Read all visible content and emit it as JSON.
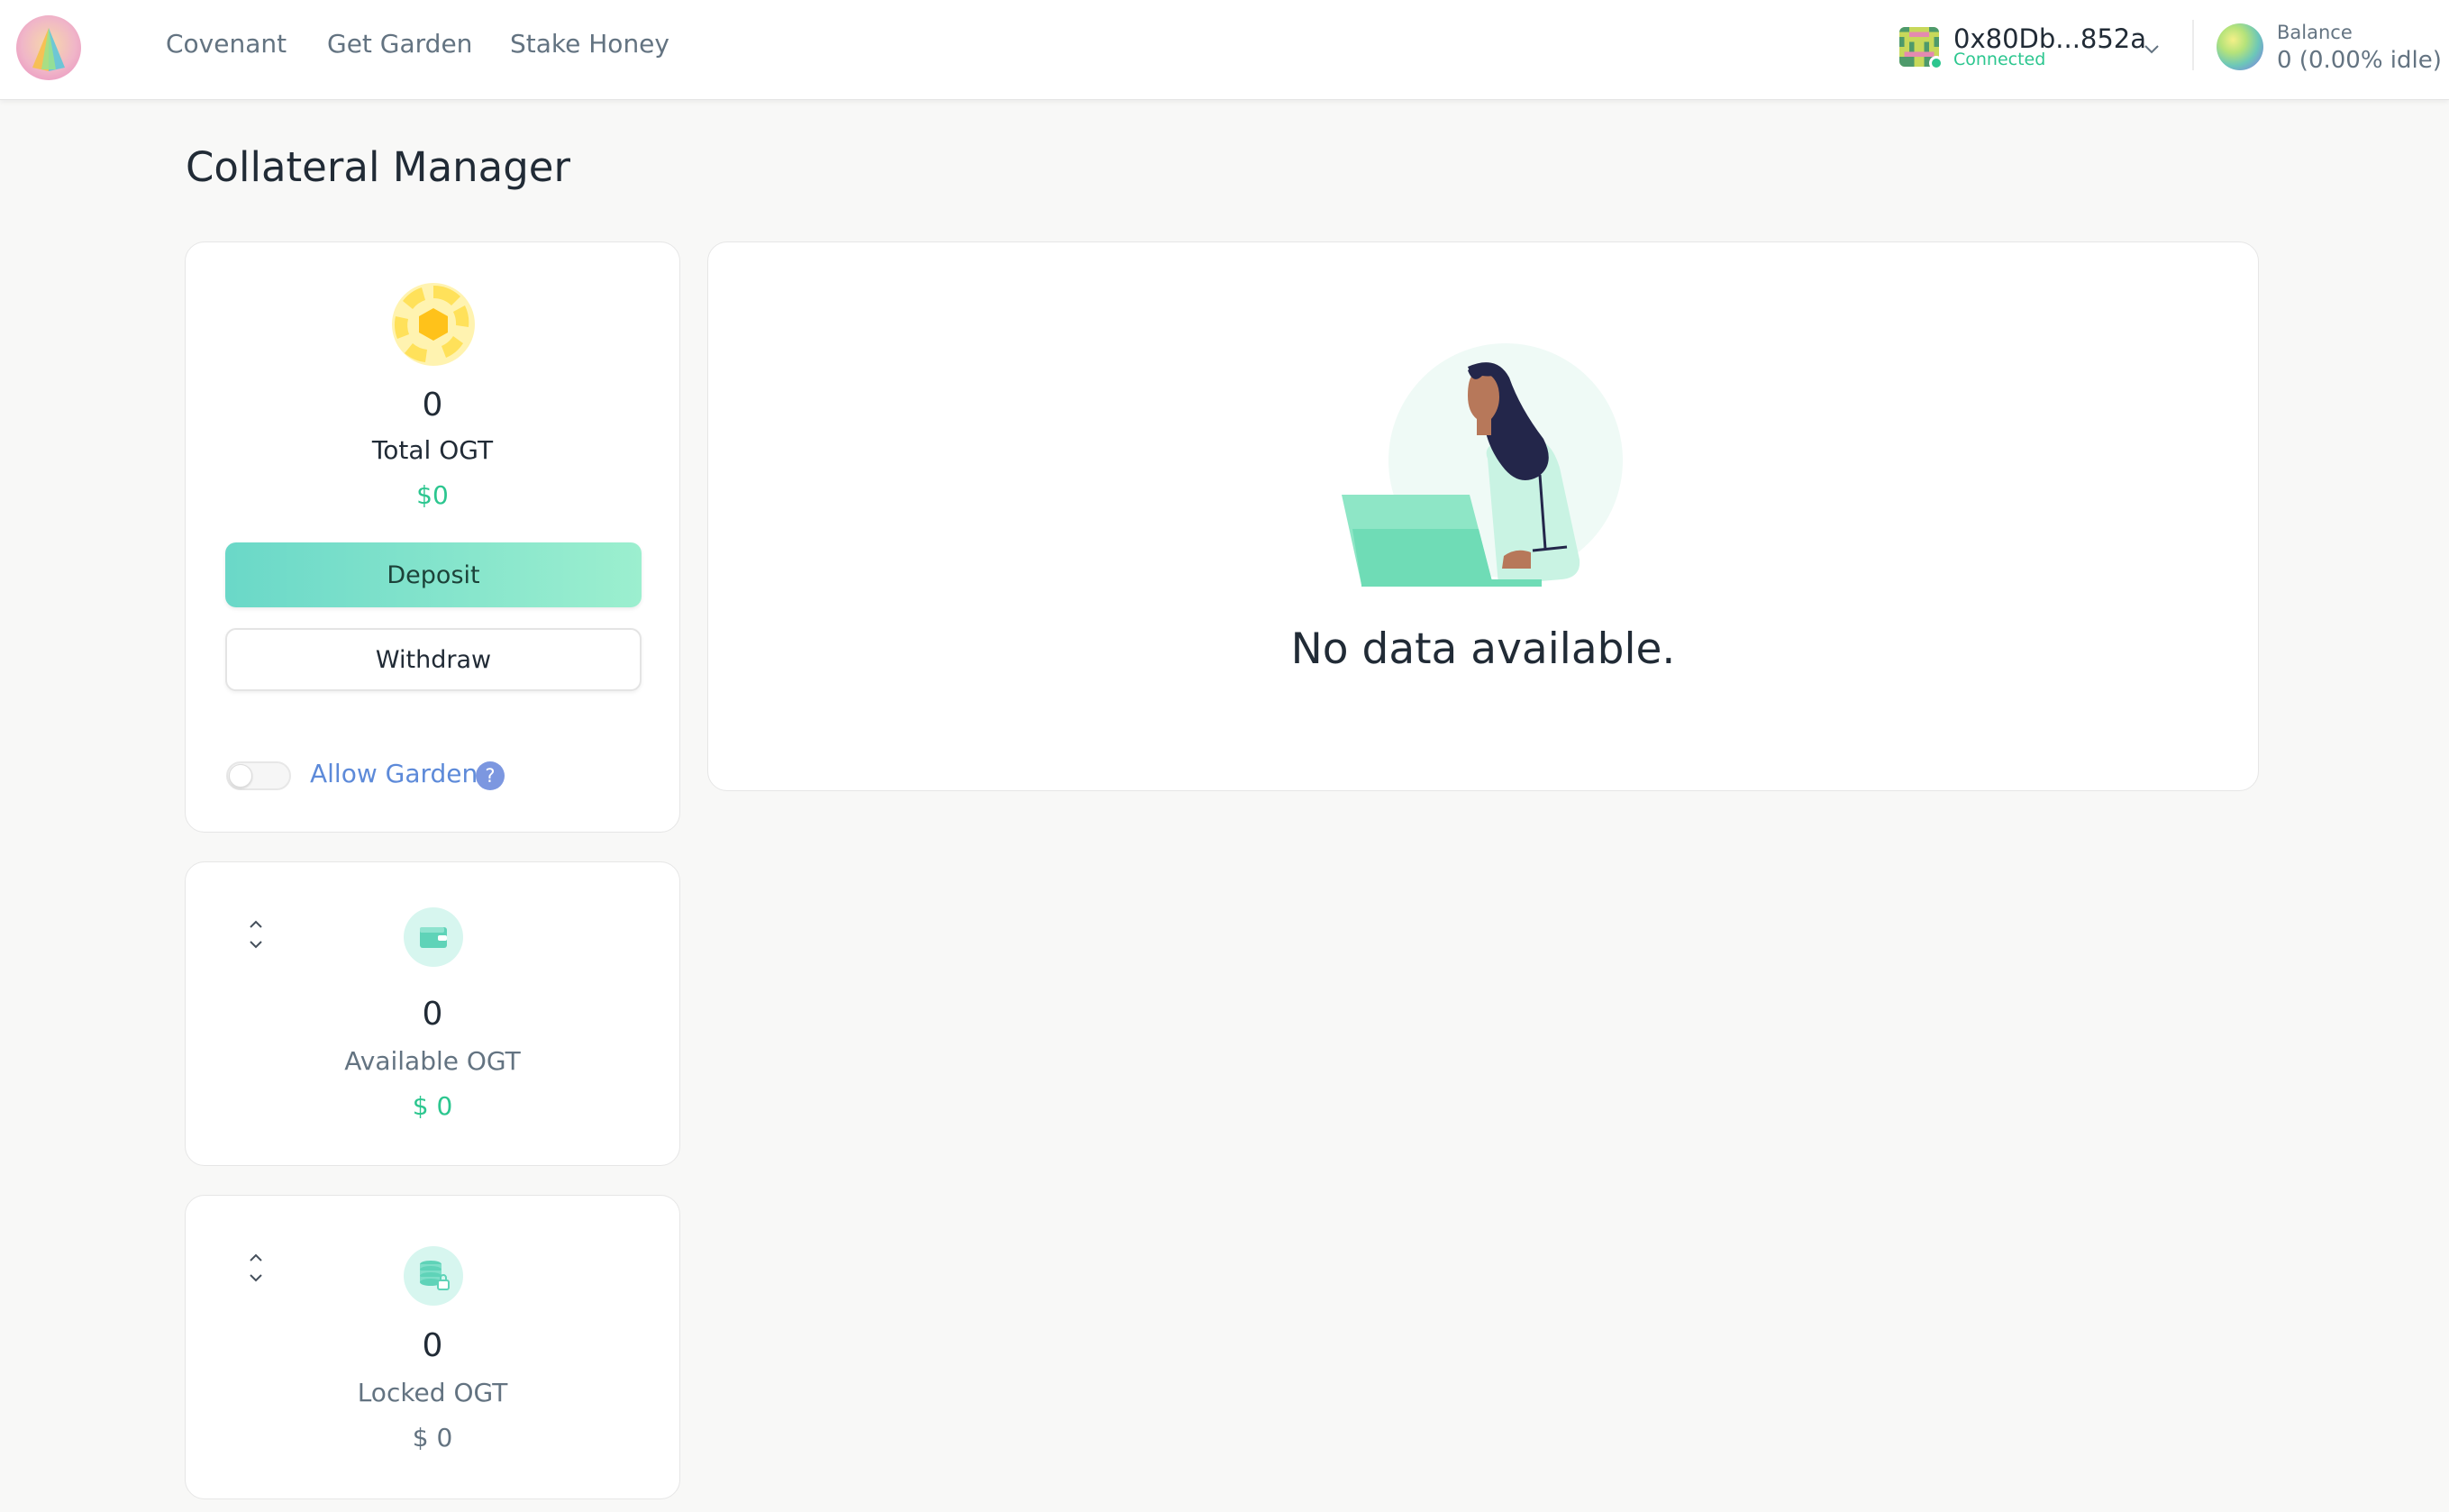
{
  "header": {
    "nav": [
      {
        "label": "Covenant"
      },
      {
        "label": "Get Garden"
      },
      {
        "label": "Stake Honey"
      }
    ],
    "account": {
      "address": "0x80Db...852a",
      "status": "Connected"
    },
    "balance": {
      "label": "Balance",
      "value": "0 (0.00% idle)"
    }
  },
  "page": {
    "title": "Collateral Manager"
  },
  "total_card": {
    "amount": "0",
    "label": "Total OGT",
    "usd": "$0",
    "deposit_label": "Deposit",
    "withdraw_label": "Withdraw",
    "allow_label": "Allow Garden",
    "help": "?",
    "allow_enabled": false
  },
  "available_card": {
    "amount": "0",
    "label": "Available OGT",
    "usd": "$ 0"
  },
  "locked_card": {
    "amount": "0",
    "label": "Locked OGT",
    "usd": "$ 0"
  },
  "empty_state": {
    "message": "No data available."
  },
  "colors": {
    "accent_green": "#2cc68f",
    "link_blue": "#5d8ad9",
    "deposit_gradient_start": "#6ad8c8",
    "deposit_gradient_end": "#9cefcf",
    "token_yellow": "#ffd83d"
  },
  "icons": {
    "logo": "prism-logo-icon",
    "account_chevron": "chevron-down-icon",
    "token": "honeycomb-token-icon",
    "available": "wallet-icon",
    "locked": "locked-coins-icon",
    "stepper": "chevron-up-down-icon"
  }
}
